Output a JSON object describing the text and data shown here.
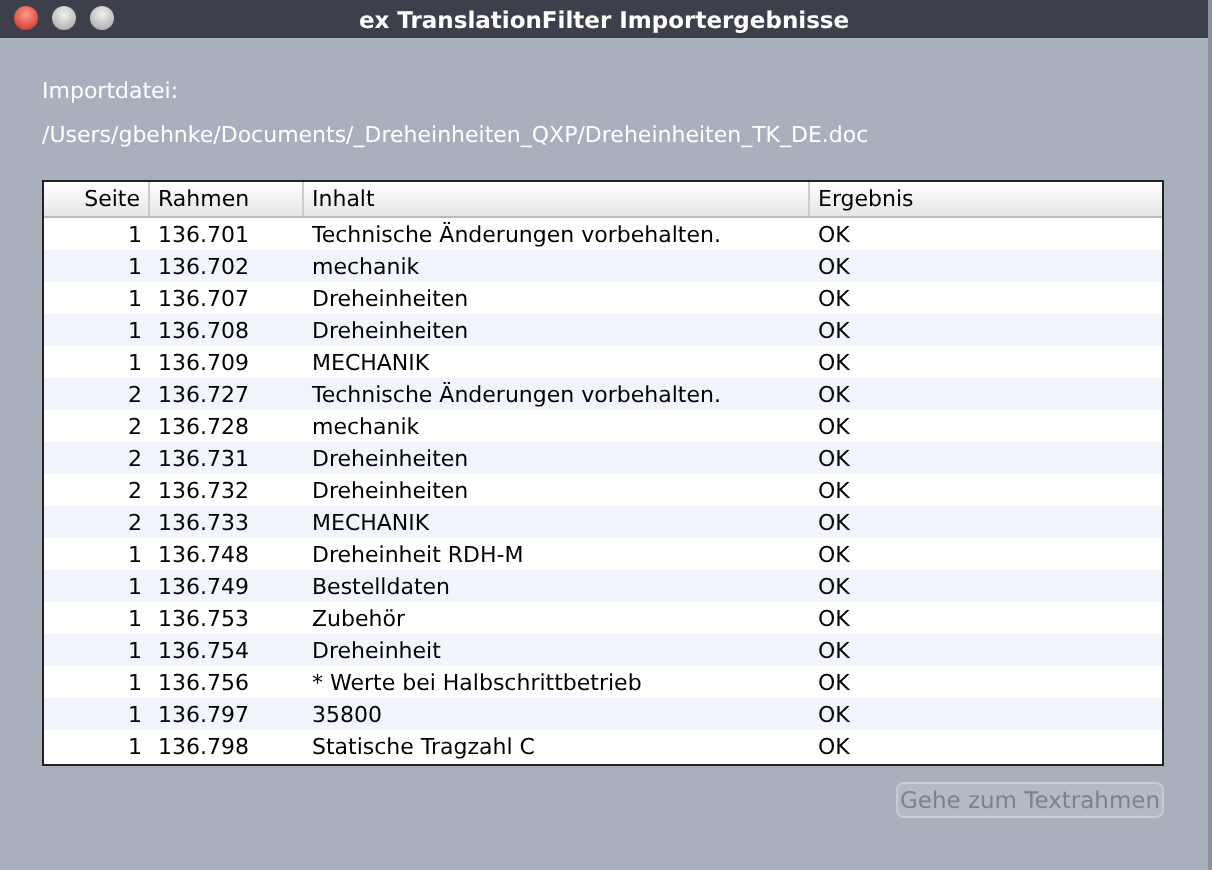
{
  "window": {
    "title": "ex TranslationFilter Importergebnisse"
  },
  "import_file": {
    "label": "Importdatei:",
    "path": "/Users/gbehnke/Documents/_Dreheinheiten_QXP/Dreheinheiten_TK_DE.doc"
  },
  "table": {
    "columns": [
      "Seite",
      "Rahmen",
      "Inhalt",
      "Ergebnis"
    ],
    "rows": [
      [
        "1",
        "136.701",
        "Technische Änderungen vorbehalten.",
        "OK"
      ],
      [
        "1",
        "136.702",
        "mechanik",
        "OK"
      ],
      [
        "1",
        "136.707",
        "Dreheinheiten",
        "OK"
      ],
      [
        "1",
        "136.708",
        "Dreheinheiten",
        "OK"
      ],
      [
        "1",
        "136.709",
        "MECHANIK",
        "OK"
      ],
      [
        "2",
        "136.727",
        "Technische Änderungen vorbehalten.",
        "OK"
      ],
      [
        "2",
        "136.728",
        "mechanik",
        "OK"
      ],
      [
        "2",
        "136.731",
        "Dreheinheiten",
        "OK"
      ],
      [
        "2",
        "136.732",
        "Dreheinheiten",
        "OK"
      ],
      [
        "2",
        "136.733",
        "MECHANIK",
        "OK"
      ],
      [
        "1",
        "136.748",
        "Dreheinheit RDH-M",
        "OK"
      ],
      [
        "1",
        "136.749",
        "Bestelldaten",
        "OK"
      ],
      [
        "1",
        "136.753",
        "Zubehör",
        "OK"
      ],
      [
        "1",
        "136.754",
        "Dreheinheit",
        "OK"
      ],
      [
        "1",
        "136.756",
        "* Werte bei Halbschrittbetrieb",
        "OK"
      ],
      [
        "1",
        "136.797",
        "35800",
        "OK"
      ],
      [
        "1",
        "136.798",
        "Statische Tragzahl C",
        "OK"
      ]
    ]
  },
  "buttons": [
    {
      "label": "Gehe zum Textrahmen",
      "disabled": true
    }
  ]
}
